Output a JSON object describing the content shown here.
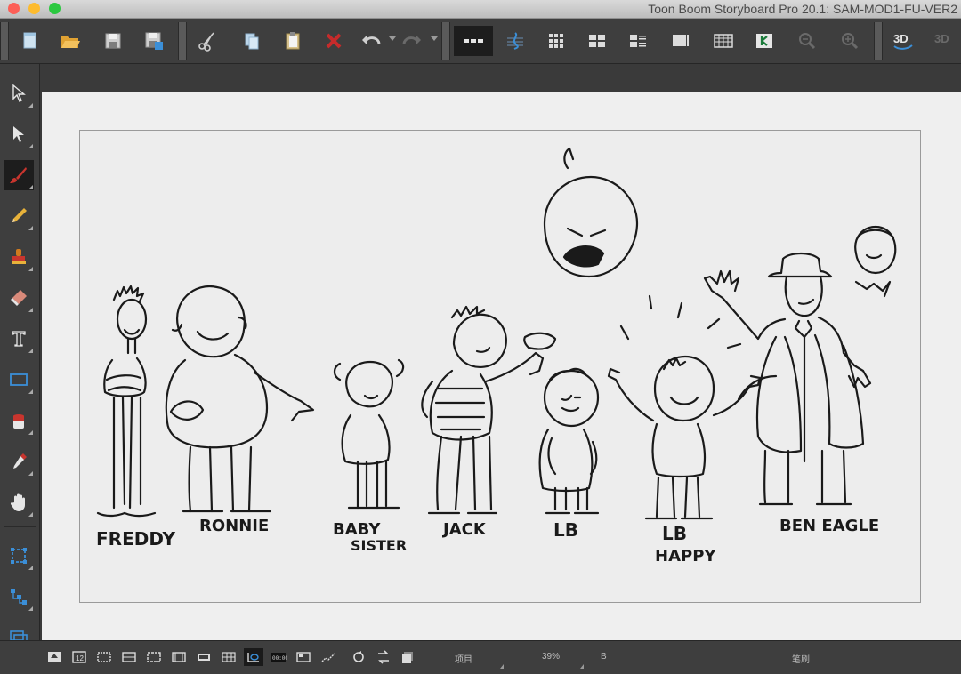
{
  "window": {
    "title": "Toon Boom Storyboard Pro 20.1:  SAM-MOD1-FU-VER2"
  },
  "colors": {
    "toolbar_bg": "#3e3e3e",
    "canvas_bg": "#efefef",
    "active_tool": "#1d1d1d"
  },
  "toolbar": {
    "buttons": [
      {
        "name": "new-project-icon"
      },
      {
        "name": "open-project-icon"
      },
      {
        "name": "save-icon"
      },
      {
        "name": "save-as-icon"
      },
      {
        "name": "cut-icon"
      },
      {
        "name": "copy-icon"
      },
      {
        "name": "paste-icon"
      },
      {
        "name": "delete-icon"
      },
      {
        "name": "undo-icon"
      },
      {
        "name": "redo-icon"
      },
      {
        "name": "timeline-view-icon"
      },
      {
        "name": "audio-icon"
      },
      {
        "name": "thumbnails-icon"
      },
      {
        "name": "panel-view-icon"
      },
      {
        "name": "page-view-icon"
      },
      {
        "name": "stage-view-icon"
      },
      {
        "name": "sheet-view-icon"
      },
      {
        "name": "keyframe-icon"
      },
      {
        "name": "zoom-out-icon"
      },
      {
        "name": "zoom-in-icon"
      },
      {
        "name": "3d-icon"
      },
      {
        "name": "3d-secondary-icon"
      }
    ],
    "threed_label": "3D"
  },
  "tools": [
    {
      "name": "select-tool-icon"
    },
    {
      "name": "transform-tool-icon"
    },
    {
      "name": "brush-tool-icon",
      "active": true
    },
    {
      "name": "pencil-tool-icon"
    },
    {
      "name": "stamp-tool-icon"
    },
    {
      "name": "eraser-tool-icon"
    },
    {
      "name": "text-tool-icon"
    },
    {
      "name": "rectangle-tool-icon"
    },
    {
      "name": "paint-tool-icon"
    },
    {
      "name": "dropper-tool-icon"
    },
    {
      "name": "hand-tool-icon"
    },
    {
      "name": "cutter-tool-icon"
    },
    {
      "name": "scene-tool-icon"
    },
    {
      "name": "layer-tool-icon"
    }
  ],
  "drawing": {
    "labels": [
      "FREDDY",
      "RONNIE",
      "BABY",
      "SISTER",
      "JACK",
      "LB",
      "LB",
      "HAPPY",
      "BEN EAGLE"
    ]
  },
  "statusbar": {
    "item_label": "项目",
    "zoom": "39%",
    "b_label": "B",
    "brush_label": "笔刷"
  }
}
